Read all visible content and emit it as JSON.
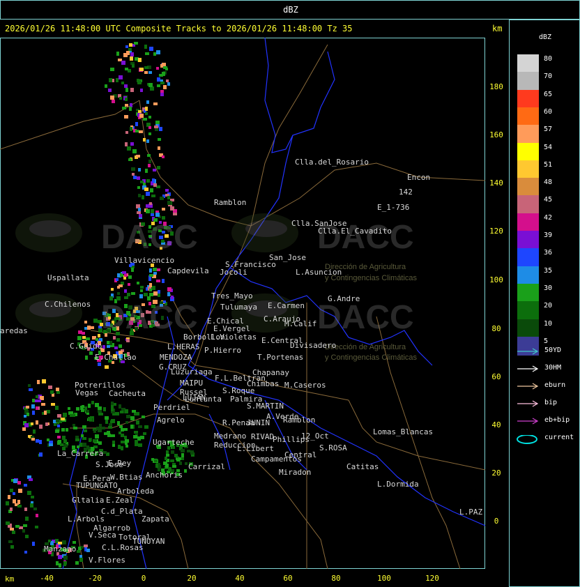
{
  "top_title": "dBZ",
  "header": {
    "text": "2026/01/26 11:48:00 UTC Composite Tracks to 2026/01/26 11:48:00 Tz 35",
    "unit": "km"
  },
  "axes": {
    "x_unit": "km",
    "x_ticks": [
      "-40",
      "-20",
      "0",
      "20",
      "40",
      "60",
      "80",
      "100",
      "120"
    ],
    "y_ticks": [
      "180",
      "160",
      "140",
      "120",
      "100",
      "80",
      "60",
      "40",
      "20",
      "0"
    ]
  },
  "legend": {
    "title": "dBZ",
    "scale": [
      {
        "label": "80",
        "color": "#d4d4d4"
      },
      {
        "label": "70",
        "color": "#b8b8b8"
      },
      {
        "label": "65",
        "color": "#ff3a1e"
      },
      {
        "label": "60",
        "color": "#ff6a14"
      },
      {
        "label": "57",
        "color": "#ff9b5a"
      },
      {
        "label": "54",
        "color": "#ffff00"
      },
      {
        "label": "51",
        "color": "#ffc830"
      },
      {
        "label": "48",
        "color": "#d98c3c"
      },
      {
        "label": "45",
        "color": "#c86478"
      },
      {
        "label": "42",
        "color": "#d40f8c"
      },
      {
        "label": "39",
        "color": "#7a0fd4"
      },
      {
        "label": "36",
        "color": "#1e46ff"
      },
      {
        "label": "35",
        "color": "#1e8ce6"
      },
      {
        "label": "30",
        "color": "#1aa01a"
      },
      {
        "label": "20",
        "color": "#0c6e0c"
      },
      {
        "label": "10",
        "color": "#0a4a0a"
      },
      {
        "label": "5",
        "color": "#3c3c96"
      }
    ],
    "tracks": [
      {
        "label": "50YD",
        "color": "#40c8c8"
      },
      {
        "label": "30HM",
        "color": "#ffffff"
      },
      {
        "label": "eburn",
        "color": "#f0c8a0"
      },
      {
        "label": "bip",
        "color": "#ffc0e0"
      },
      {
        "label": "eb+bip",
        "color": "#d040d0"
      },
      {
        "label": "current",
        "color": "#00e0e0"
      }
    ]
  },
  "watermark": {
    "brand": "DACC",
    "line1": "Dirección de Agricultura",
    "line2": "y Contingencias Climáticas"
  },
  "places": [
    "Clla.del_Rosario",
    "Encon",
    "142",
    "E_1-736",
    "Ramblon",
    "Clla.SanJose",
    "Clla.El_Cavadito",
    "San_Jose",
    "Villavicencio",
    "Uspallata",
    "C.Chilenos",
    "Capdevila",
    "S.Francisco",
    "L.Asuncion",
    "Jocoli",
    "Tres_Mayo",
    "G.Andre",
    "Tulumaya",
    "E.Carmen",
    "E.Chical",
    "C.Araujo",
    "M.Calif",
    "E.Vergel",
    "Borbollon",
    "L.Violetas",
    "E.Central",
    "P.Hierro",
    "Divisadero",
    "L.HERAS",
    "T.Portenas",
    "C.Guido",
    "E.Challao",
    "MENDOZA",
    "G.CRUZ",
    "Luzuriaga",
    "Chapanay",
    "F.L.Beltran",
    "Chimbas",
    "M.Caseros",
    "Potrerillos",
    "MAIPU",
    "Russel",
    "S.Roque",
    "Palmira",
    "Vegas",
    "Cacheuta",
    "LUJAN",
    "Lunlunta",
    "Perdriel",
    "S.MARTIN",
    "A.Verde",
    "Ramblon",
    "Agrelo",
    "R.Penaa",
    "JUNIN",
    "Lomas_Blancas",
    "Ugarteche",
    "Medrano",
    "RIVAD",
    "Phillips",
    "12_Oct",
    "Reduccion",
    "L.Libert",
    "Campamentos",
    "S.ROSA",
    "La_Carrera",
    "Central",
    "Catitas",
    "Carrizal",
    "E.Rey",
    "S.Jose",
    "Miradon",
    "Anchoris",
    "W.Btias",
    "E.Pera",
    "TUPUNGATO",
    "L.Dormida",
    "Arboleda",
    "Gltalia",
    "E.Zeal",
    "C.d_Plata",
    "L.Arbols",
    "Zapata",
    "L.PAZ",
    "Algarrob",
    "V.Seca",
    "Totoral",
    "TUNUYAN",
    "Manzano",
    "C.L.Rosas",
    "V.Flores",
    "aredas"
  ]
}
